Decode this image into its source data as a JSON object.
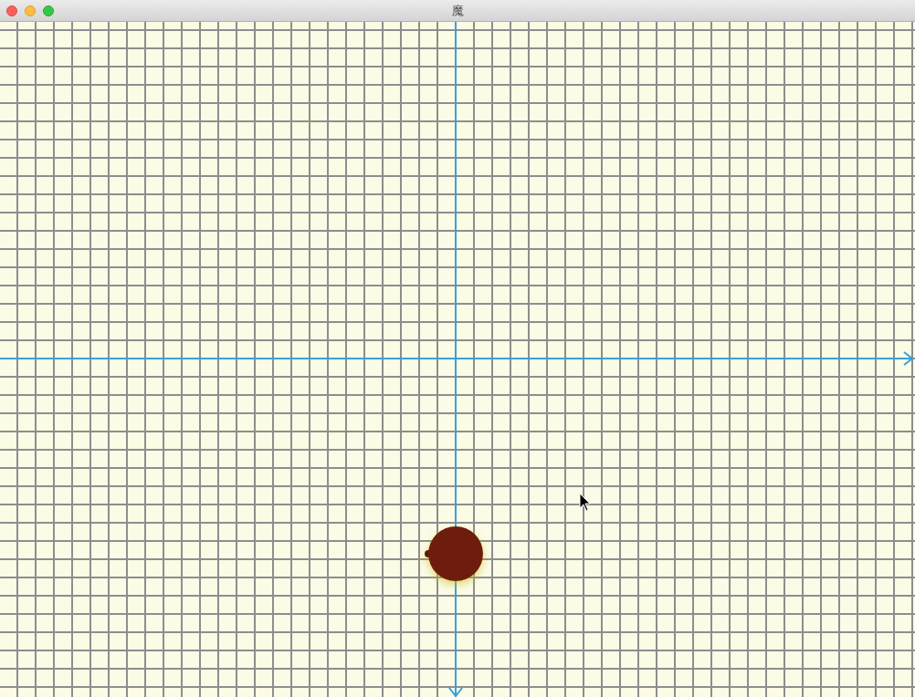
{
  "window": {
    "title": "魔"
  }
}
